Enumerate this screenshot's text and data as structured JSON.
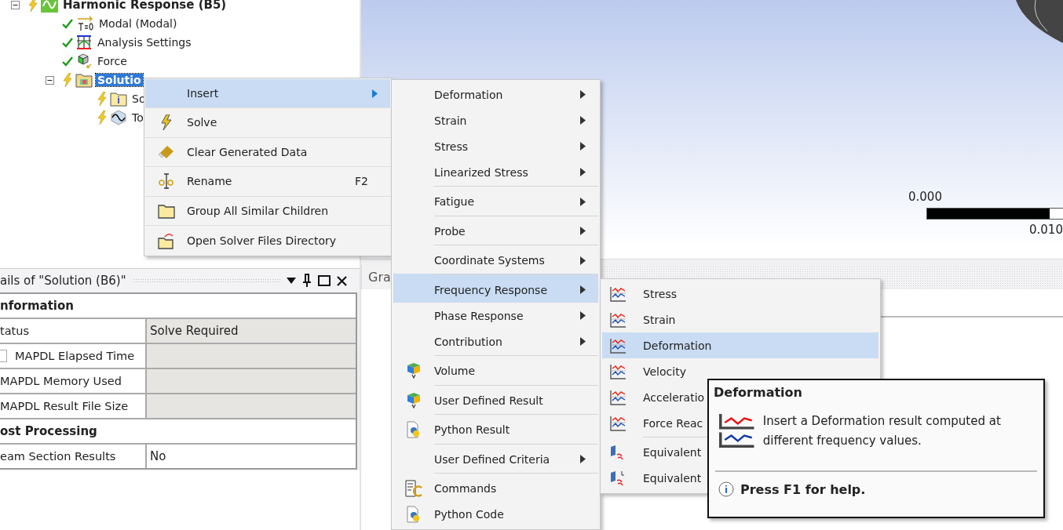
{
  "tree": {
    "label": "Harmonic Response (B5)",
    "solved": false,
    "kind": "harmonic",
    "expanded": true,
    "selected": false,
    "children": [
      {
        "label": "Modal (Modal)",
        "solved": true,
        "kind": "modal",
        "selected": false
      },
      {
        "label": "Analysis Settings",
        "solved": true,
        "kind": "settings",
        "selected": false
      },
      {
        "label": "Force",
        "solved": true,
        "kind": "force",
        "selected": false
      },
      {
        "label": "Solutio",
        "solved": false,
        "kind": "solution",
        "expanded": true,
        "selected": true,
        "children": [
          {
            "label": "So",
            "solved": false,
            "kind": "info",
            "selected": false
          },
          {
            "label": "To",
            "solved": false,
            "kind": "tool",
            "selected": false
          }
        ]
      }
    ]
  },
  "details": {
    "title": "ails of \"Solution (B6)\"",
    "rows": [
      {
        "kind": "header",
        "label": "nformation"
      },
      {
        "kind": "row",
        "label": "tatus",
        "value": "Solve Required",
        "shaded": true
      },
      {
        "kind": "checkrow",
        "label": "MAPDL Elapsed Time",
        "checked": false,
        "shaded": true
      },
      {
        "kind": "row",
        "label": "MAPDL Memory Used",
        "shaded": true
      },
      {
        "kind": "row",
        "label": "MAPDL Result File Size",
        "shaded": true
      },
      {
        "kind": "header",
        "label": "ost Processing"
      },
      {
        "kind": "row",
        "label": "eam Section Results",
        "value": "No",
        "shaded": false
      }
    ]
  },
  "viewport": {
    "scale_min": "0.000",
    "scale_max": "0.010"
  },
  "graph_tab": {
    "label": "Gra"
  },
  "context_menu": [
    {
      "label": "Insert",
      "kind": "plain",
      "submenu": true,
      "selected": true
    },
    {
      "label": "Solve",
      "kind": "solve",
      "submenu": false,
      "selected": false
    },
    {
      "label": "Clear Generated Data",
      "kind": "eraser",
      "submenu": false,
      "selected": false
    },
    {
      "label": "Rename",
      "kind": "rename",
      "shortcut": "F2",
      "submenu": false,
      "selected": false
    },
    {
      "label": "Group All Similar Children",
      "kind": "folder",
      "submenu": false,
      "selected": false
    },
    {
      "label": "Open Solver Files Directory",
      "kind": "directory",
      "submenu": false,
      "selected": false
    }
  ],
  "insert_menu": [
    {
      "label": "Deformation",
      "kind": "plain",
      "submenu": true,
      "selected": false,
      "separator_above": false
    },
    {
      "label": "Strain",
      "kind": "plain",
      "submenu": true,
      "selected": false,
      "separator_above": false
    },
    {
      "label": "Stress",
      "kind": "plain",
      "submenu": true,
      "selected": false,
      "separator_above": false
    },
    {
      "label": "Linearized Stress",
      "kind": "plain",
      "submenu": true,
      "selected": false,
      "separator_above": false
    },
    {
      "label": "Fatigue",
      "kind": "plain",
      "submenu": true,
      "selected": false,
      "separator_above": true
    },
    {
      "label": "Probe",
      "kind": "plain",
      "submenu": true,
      "selected": false,
      "separator_above": true
    },
    {
      "label": "Coordinate Systems",
      "kind": "plain",
      "submenu": true,
      "selected": false,
      "separator_above": true
    },
    {
      "label": "Frequency Response",
      "kind": "plain",
      "submenu": true,
      "selected": true,
      "separator_above": true
    },
    {
      "label": "Phase Response",
      "kind": "plain",
      "submenu": true,
      "selected": false,
      "separator_above": false
    },
    {
      "label": "Contribution",
      "kind": "plain",
      "submenu": true,
      "selected": false,
      "separator_above": false
    },
    {
      "label": "Volume",
      "kind": "volume",
      "submenu": false,
      "selected": false,
      "separator_above": true
    },
    {
      "label": "User Defined Result",
      "kind": "user",
      "submenu": false,
      "selected": false,
      "separator_above": true
    },
    {
      "label": "Python Result",
      "kind": "python",
      "submenu": false,
      "selected": false,
      "separator_above": true
    },
    {
      "label": "User Defined Criteria",
      "kind": "plain",
      "submenu": true,
      "selected": false,
      "separator_above": true
    },
    {
      "label": "Commands",
      "kind": "commands",
      "submenu": false,
      "selected": false,
      "separator_above": true
    },
    {
      "label": "Python Code",
      "kind": "python",
      "submenu": false,
      "selected": false,
      "separator_above": false
    }
  ],
  "frequency_menu": [
    {
      "label": "Stress",
      "kind": "freq",
      "selected": false,
      "separator_above": false
    },
    {
      "label": "Strain",
      "kind": "freq",
      "selected": false,
      "separator_above": false
    },
    {
      "label": "Deformation",
      "kind": "freq",
      "selected": true,
      "separator_above": false
    },
    {
      "label": "Velocity",
      "kind": "freq",
      "selected": false,
      "separator_above": false
    },
    {
      "label": "Acceleratio",
      "kind": "freq",
      "selected": false,
      "separator_above": false
    },
    {
      "label": "Force Reac",
      "kind": "freq",
      "selected": false,
      "separator_above": false
    },
    {
      "label": "Equivalent",
      "kind": "equiv",
      "selected": false,
      "separator_above": true
    },
    {
      "label": "Equivalent",
      "kind": "equiv2",
      "selected": false,
      "separator_above": false
    }
  ],
  "tooltip": {
    "title": "Deformation",
    "text": "Insert a Deformation result computed at different frequency values.",
    "help": "Press F1 for help."
  }
}
